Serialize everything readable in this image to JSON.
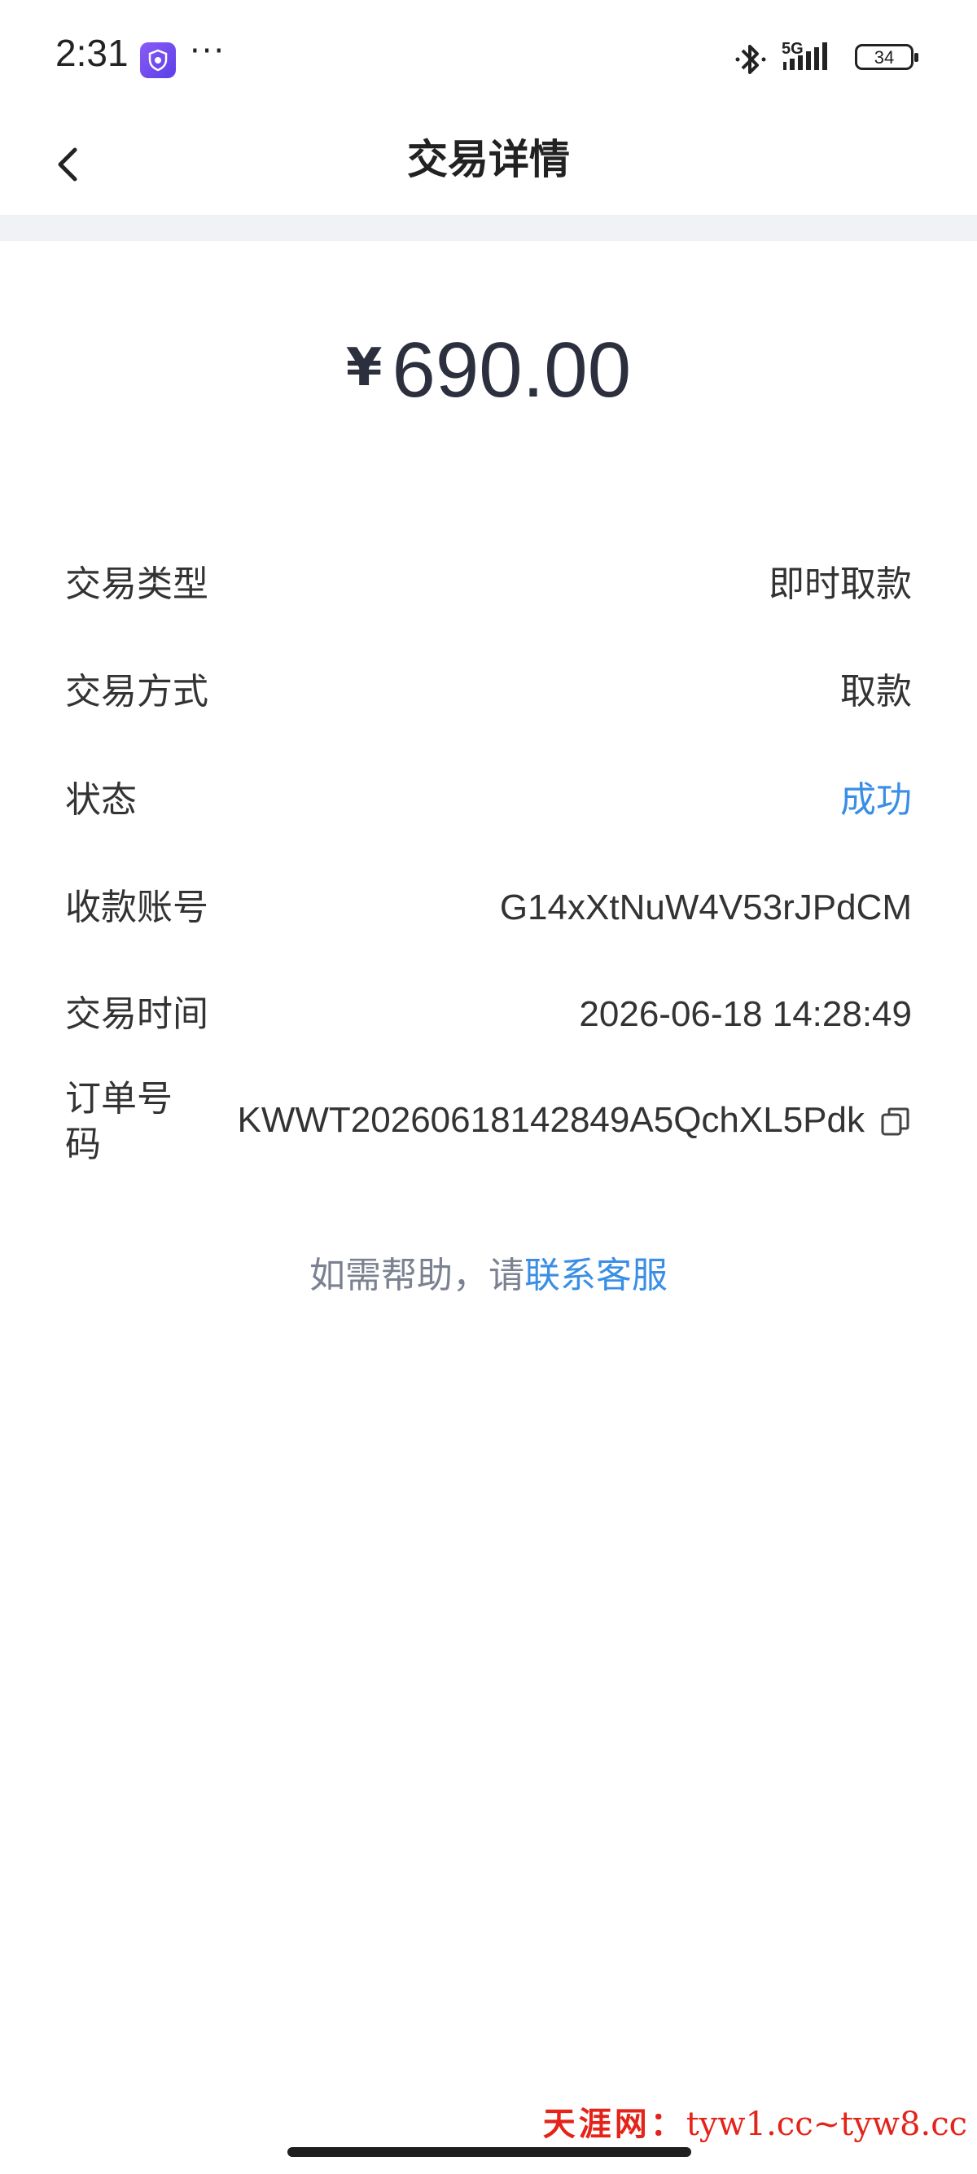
{
  "status_bar": {
    "time": "2:31",
    "more": "···",
    "network": "5G",
    "battery": "34"
  },
  "nav": {
    "title": "交易详情"
  },
  "amount": {
    "currency": "¥",
    "value": "690.00"
  },
  "details": [
    {
      "label": "交易类型",
      "value": "即时取款"
    },
    {
      "label": "交易方式",
      "value": "取款"
    },
    {
      "label": "状态",
      "value": "成功"
    },
    {
      "label": "收款账号",
      "value": "G14xXtNuW4V53rJPdCM"
    },
    {
      "label": "交易时间",
      "value": "2026-06-18 14:28:49"
    },
    {
      "label": "订单号码",
      "value": "KWWT20260618142849A5QchXL5Pdk"
    }
  ],
  "help": {
    "prefix": "如需帮助，请",
    "link": "联系客服"
  },
  "watermark": {
    "brand": "天涯网：",
    "text": "tyw1.cc~tyw8.cc"
  },
  "colors": {
    "accent": "#3a8ee6",
    "separator": "#f1f2f6",
    "amount": "#2c2f3e",
    "watermark": "#e4231a"
  }
}
